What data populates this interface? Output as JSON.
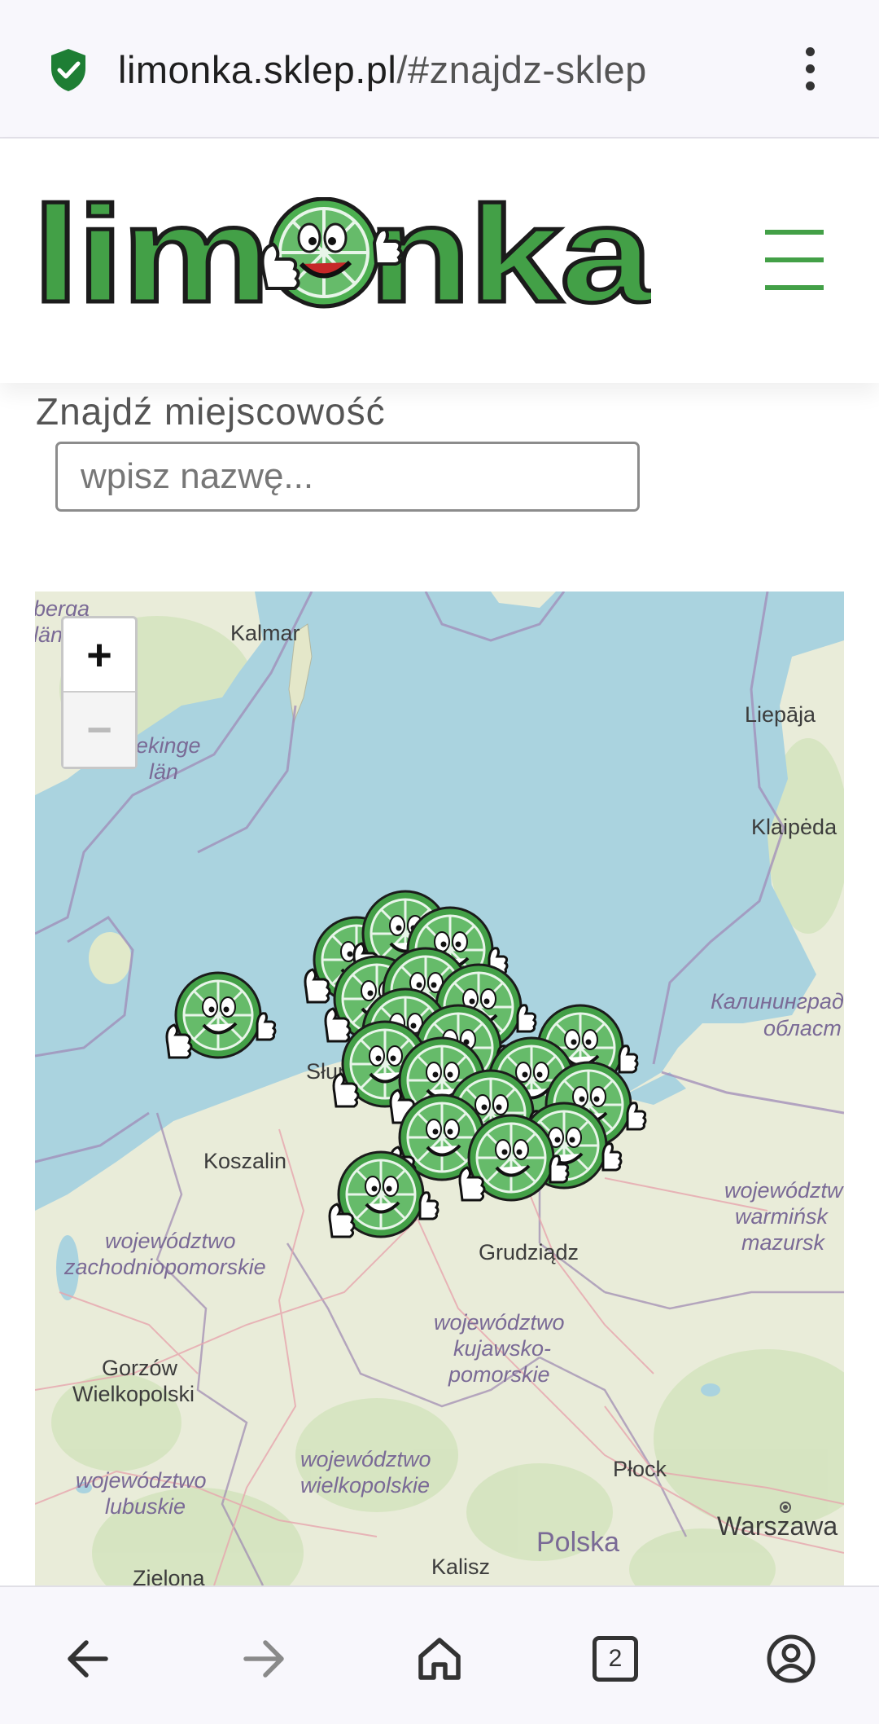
{
  "browser": {
    "url_host": "limonka.sklep.pl",
    "url_path": "/#znajdz-sklep",
    "tab_count": "2"
  },
  "header": {
    "logo_text": "limonka"
  },
  "search": {
    "label": "Znajdź miejscowość",
    "placeholder": "wpisz nazwę..."
  },
  "map": {
    "zoom_in": "+",
    "zoom_out": "−",
    "labels": {
      "kalmar": "Kalmar",
      "blekinge": "ekinge",
      "lan": "län",
      "liepaja": "Liepāja",
      "klaipeda": "Klaipėda",
      "kaliningrad": "Калининград",
      "oblast": "област",
      "slupsk": "Słups",
      "koszalin": "Koszalin",
      "zachodnio1": "województwo",
      "zachodnio2": "zachodniopomorskie",
      "grudziadz": "Grudziądz",
      "warm1": "województw",
      "warm2": "warmińsk",
      "warm3": "mazursk",
      "kuj1": "województwo",
      "kuj2": "kujawsko-",
      "kuj3": "pomorskie",
      "gorzow1": "Gorzów",
      "gorzow2": "Wielkopolski",
      "lub1": "województwo",
      "lub2": "lubuskie",
      "wlkp1": "województwo",
      "wlkp2": "wielkopolskie",
      "plock": "Płock",
      "warszawa": "Warszawa",
      "polska": "Polska",
      "kalisz": "Kalisz",
      "zielona": "Zielona",
      "skane1": "berga",
      "skane2": "län"
    }
  }
}
